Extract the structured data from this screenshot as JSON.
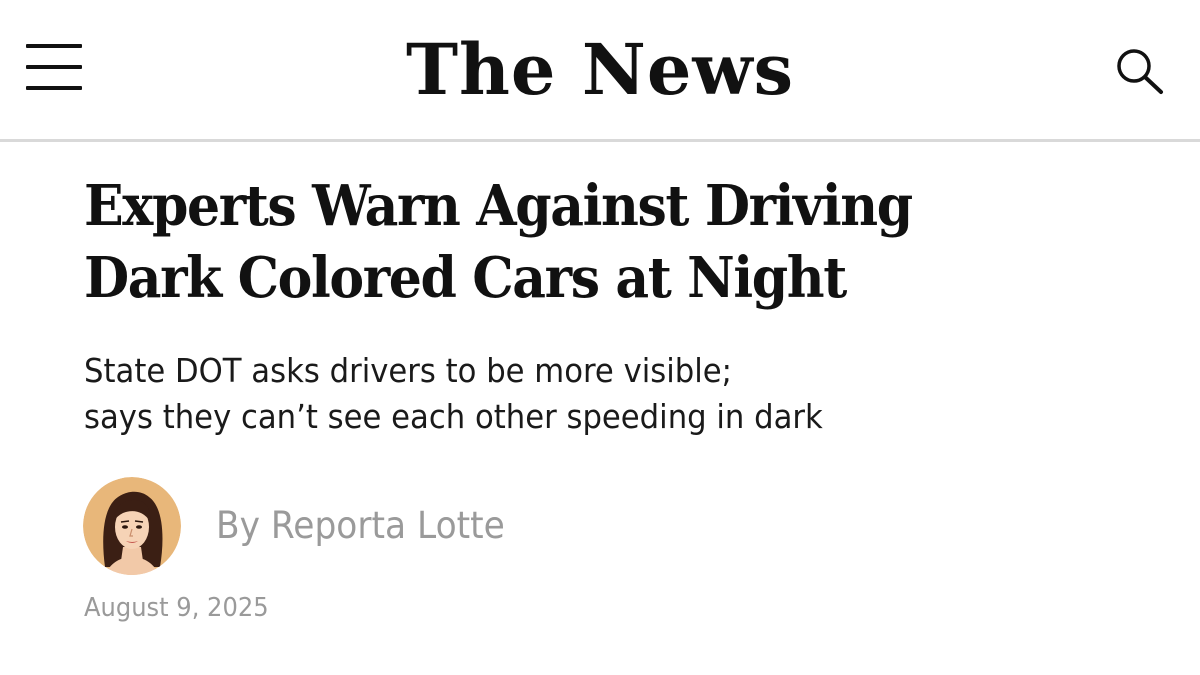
{
  "header": {
    "masthead": "The News",
    "menu_icon": "hamburger-menu-icon",
    "search_icon": "search-icon"
  },
  "article": {
    "headline_lines": [
      "Experts Warn Against Driving",
      "Dark Colored Cars at Night"
    ],
    "subheadline_lines": [
      "State DOT asks drivers to be more visible;",
      "says they can’t see each other speeding in dark"
    ],
    "byline": "By Reporta Lotte",
    "date": "August 9, 2025"
  },
  "colors": {
    "text": "#111111",
    "muted": "#9a9a9a",
    "divider": "#d9d9d9",
    "avatar_bg": "#e8b77a"
  }
}
